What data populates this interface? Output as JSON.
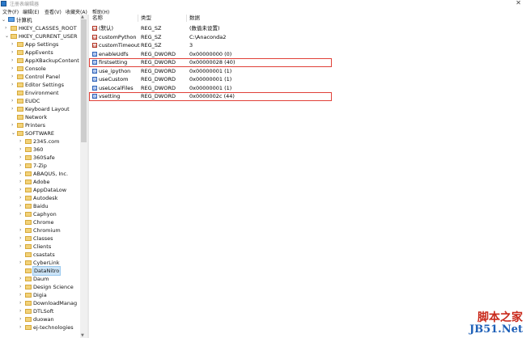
{
  "window": {
    "title": "注册表编辑器",
    "close_glyph": "✕"
  },
  "menu": [
    "文件(F)",
    "编辑(E)",
    "查看(V)",
    "收藏夹(A)",
    "帮助(H)"
  ],
  "tree": {
    "root": "计算机",
    "items": [
      {
        "label": "HKEY_CLASSES_ROOT",
        "level": 1,
        "toggle": "›"
      },
      {
        "label": "HKEY_CURRENT_USER",
        "level": 1,
        "toggle": "⌄"
      },
      {
        "label": "App Settings",
        "level": 2,
        "toggle": "›"
      },
      {
        "label": "AppEvents",
        "level": 2,
        "toggle": "›"
      },
      {
        "label": "AppXBackupContent",
        "level": 2,
        "toggle": "›"
      },
      {
        "label": "Console",
        "level": 2,
        "toggle": "›"
      },
      {
        "label": "Control Panel",
        "level": 2,
        "toggle": "›"
      },
      {
        "label": "Editor Settings",
        "level": 2,
        "toggle": "›"
      },
      {
        "label": "Environment",
        "level": 2,
        "toggle": ""
      },
      {
        "label": "EUDC",
        "level": 2,
        "toggle": "›"
      },
      {
        "label": "Keyboard Layout",
        "level": 2,
        "toggle": "›"
      },
      {
        "label": "Network",
        "level": 2,
        "toggle": ""
      },
      {
        "label": "Printers",
        "level": 2,
        "toggle": "›"
      },
      {
        "label": "SOFTWARE",
        "level": 2,
        "toggle": "⌄"
      },
      {
        "label": "2345.com",
        "level": 3,
        "toggle": "›"
      },
      {
        "label": "360",
        "level": 3,
        "toggle": "›"
      },
      {
        "label": "360Safe",
        "level": 3,
        "toggle": "›"
      },
      {
        "label": "7-Zip",
        "level": 3,
        "toggle": "›"
      },
      {
        "label": "ABAQUS, Inc.",
        "level": 3,
        "toggle": "›"
      },
      {
        "label": "Adobe",
        "level": 3,
        "toggle": "›"
      },
      {
        "label": "AppDataLow",
        "level": 3,
        "toggle": "›"
      },
      {
        "label": "Autodesk",
        "level": 3,
        "toggle": "›"
      },
      {
        "label": "Baidu",
        "level": 3,
        "toggle": "›"
      },
      {
        "label": "Caphyon",
        "level": 3,
        "toggle": "›"
      },
      {
        "label": "Chrome",
        "level": 3,
        "toggle": ""
      },
      {
        "label": "Chromium",
        "level": 3,
        "toggle": "›"
      },
      {
        "label": "Classes",
        "level": 3,
        "toggle": "›"
      },
      {
        "label": "Clients",
        "level": 3,
        "toggle": "›"
      },
      {
        "label": "csastats",
        "level": 3,
        "toggle": ""
      },
      {
        "label": "CyberLink",
        "level": 3,
        "toggle": "›"
      },
      {
        "label": "DataNitro",
        "level": 3,
        "toggle": "",
        "selected": true
      },
      {
        "label": "Daum",
        "level": 3,
        "toggle": "›"
      },
      {
        "label": "Design Science",
        "level": 3,
        "toggle": "›"
      },
      {
        "label": "Digia",
        "level": 3,
        "toggle": "›"
      },
      {
        "label": "DownloadManag",
        "level": 3,
        "toggle": "›"
      },
      {
        "label": "DTLSoft",
        "level": 3,
        "toggle": "›"
      },
      {
        "label": "duowan",
        "level": 3,
        "toggle": "›"
      },
      {
        "label": "ej-technologies",
        "level": 3,
        "toggle": "›"
      }
    ]
  },
  "values": {
    "columns": [
      "名称",
      "类型",
      "数据"
    ],
    "rows": [
      {
        "name": "(默认)",
        "type": "REG_SZ",
        "data": "(数值未设置)",
        "kind": "sz"
      },
      {
        "name": "customPython",
        "type": "REG_SZ",
        "data": "C:\\Anaconda2",
        "kind": "sz"
      },
      {
        "name": "customTimeout",
        "type": "REG_SZ",
        "data": "3",
        "kind": "sz"
      },
      {
        "name": "enableUdfs",
        "type": "REG_DWORD",
        "data": "0x00000000 (0)",
        "kind": "dw"
      },
      {
        "name": "firstsetting",
        "type": "REG_DWORD",
        "data": "0x00000028 (40)",
        "kind": "dw",
        "highlighted": true
      },
      {
        "name": "use_ipython",
        "type": "REG_DWORD",
        "data": "0x00000001 (1)",
        "kind": "dw"
      },
      {
        "name": "useCustom",
        "type": "REG_DWORD",
        "data": "0x00000001 (1)",
        "kind": "dw"
      },
      {
        "name": "useLocalFiles",
        "type": "REG_DWORD",
        "data": "0x00000001 (1)",
        "kind": "dw"
      },
      {
        "name": "vsetting",
        "type": "REG_DWORD",
        "data": "0x0000002c (44)",
        "kind": "dw",
        "highlighted": true
      }
    ]
  },
  "watermark": {
    "line1": "脚本之家",
    "line2": "JB51.Net"
  },
  "colors": {
    "highlight_box": "#e04038",
    "selection": "#cce4f7",
    "folder": "#f2d27a"
  }
}
